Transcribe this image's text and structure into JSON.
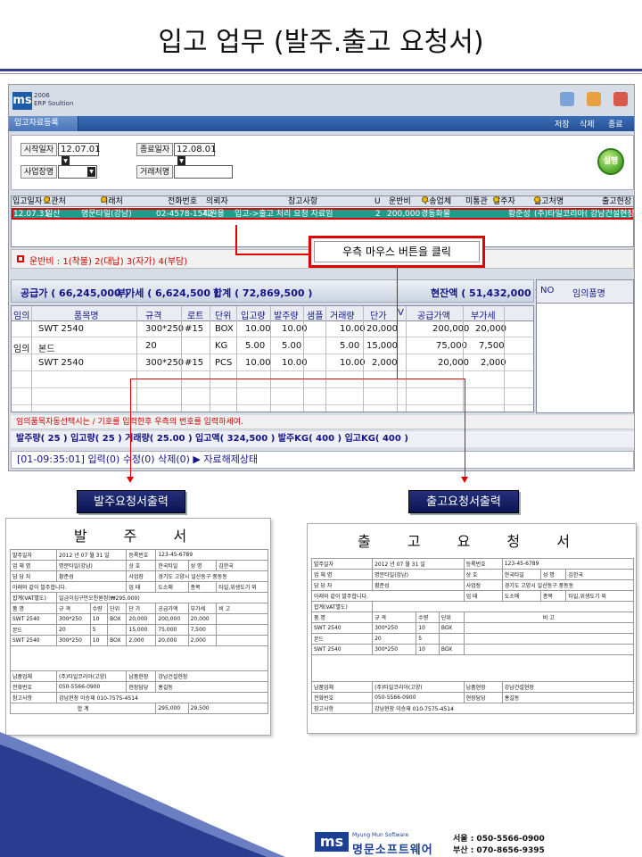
{
  "slide_title": "입고 업무 (발주.출고 요청서)",
  "window": {
    "logo_mark": "ms",
    "logo_year": "2006",
    "logo_text": "ERP Soultion",
    "tab": "입고자료등록",
    "actions": [
      "저장",
      "삭제",
      "종료"
    ]
  },
  "filter": {
    "start_label": "시작일자",
    "start_value": "12.07.01",
    "end_label": "종료일자",
    "end_value": "12.08.01",
    "biz_label": "사업장명",
    "biz_value": "",
    "client_label": "거래처명",
    "client_value": "",
    "run_button": "실행"
  },
  "grid1": {
    "headers": [
      "입고일자",
      "보관처",
      "거래처",
      "전화번호",
      "의뢰자",
      "참고사항",
      "U",
      "운반비",
      "우송업체",
      "미통관",
      "발주자",
      "출고처명",
      "",
      "출고현장"
    ],
    "row": [
      "12.07.31",
      "일산",
      "명문타일(강남)",
      "02-4578-1542",
      "지원용",
      "입고->출고 처리 요청 자료임",
      "2",
      "200,000",
      "경동화물",
      "",
      "황준성",
      "(주)타일코리아(",
      "",
      "강남건설현장"
    ]
  },
  "freight_note": "운반비 : 1(착불) 2(대납) 3(자가) 4(부담)",
  "callout": "우측 마우스 버튼을 클릭",
  "totals": {
    "supply": "공급가 (     66,245,000 )",
    "vat": "부가세 (     6,624,500 )",
    "total": "합계 (     72,869,500 )",
    "cash": "현잔액 (     51,432,000 )"
  },
  "grid2": {
    "headers": [
      "임의",
      "품목명",
      "규격",
      "로트",
      "단위",
      "입고량",
      "발주량",
      "샘플",
      "거래량",
      "단가",
      "V",
      "공급가액",
      "부가세"
    ],
    "rows": [
      [
        "",
        "SWT 2540",
        "300*250",
        "#15",
        "BOX",
        "10.00",
        "10.00",
        "",
        "10.00",
        "20,000",
        "",
        "200,000",
        "20,000"
      ],
      [
        "임의",
        "본드",
        "20",
        "",
        "KG",
        "5.00",
        "5.00",
        "",
        "5.00",
        "15,000",
        "",
        "75,000",
        "7,500"
      ],
      [
        "",
        "SWT 2540",
        "300*250",
        "#15",
        "PCS",
        "10.00",
        "10.00",
        "",
        "10.00",
        "2,000",
        "",
        "20,000",
        "2,000"
      ]
    ]
  },
  "side": {
    "no": "NO",
    "title": "임의품명"
  },
  "hint": "임의품목자동선택시는 / 기호를 입력한후 우측의 번호를 입력하세여.",
  "summary": "발주량(     25 )    입고량(     25 )    거래량(     25.00 )    입고액(          324,500 )    발주KG(     400 )    입고KG(     400 )",
  "status": "[01-09:35:01] 입력(0) 수정(0) 삭제(0) ▶ 자료해제상태",
  "labels": {
    "order": "발주요청서출력",
    "ship": "출고요청서출력"
  },
  "doc_order": {
    "title": "발 주 서",
    "rows": [
      [
        "발주일자",
        "2012 년 07 월 31 일",
        "등록번호",
        "123-45-6789"
      ],
      [
        "업 체 명",
        "명문타일(강남)",
        "상 호",
        "한국타일",
        "성 명",
        "김한국"
      ],
      [
        "담 당 자",
        "황준성",
        "사업장",
        "경기도 고양시 일산동구 풍동동"
      ],
      [
        "아래와 같이 발주합니다.",
        "",
        "업 태",
        "도소매",
        "종목",
        "타일,위생도기 외"
      ],
      [
        "합계(VAT별도)",
        "일금이십구만오천원정(₩295,000)"
      ],
      [
        "품 명",
        "규 격",
        "수량",
        "단위",
        "단 가",
        "공급가액",
        "부가세",
        "비 고"
      ],
      [
        "SWT 2540",
        "300*250",
        "10",
        "BOX",
        "20,000",
        "200,000",
        "20,000",
        ""
      ],
      [
        "본드",
        "20",
        "5",
        "",
        "15,000",
        "75,000",
        "7,500",
        ""
      ],
      [
        "SWT 2540",
        "300*250",
        "10",
        "BOX",
        "2,000",
        "20,000",
        "2,000",
        ""
      ],
      [
        "납품업체",
        "(주)타일코리아(고양)",
        "납품현장",
        "강남건설현장"
      ],
      [
        "전화번호",
        "050-5566-0900",
        "현장담당",
        "홍길동"
      ],
      [
        "참고사항",
        "강남현장 이승재 010-7575-4514"
      ],
      [
        "합 계",
        "",
        "295,000",
        "29,500"
      ]
    ]
  },
  "doc_ship": {
    "title": "출 고 요 청 서",
    "rows": [
      [
        "발주일자",
        "2012 년 07 월 31 일",
        "등록번호",
        "123-45-6789"
      ],
      [
        "업 체 명",
        "명문타일(강남)",
        "상 호",
        "한국타일",
        "성 명",
        "김한국"
      ],
      [
        "담 당 자",
        "황준성",
        "사업장",
        "경기도 고양시 일산동구 풍동동"
      ],
      [
        "아래와 같이 발주합니다.",
        "",
        "업 태",
        "도소매",
        "종목",
        "타일,위생도기 외"
      ],
      [
        "합계(VAT별도)",
        ""
      ],
      [
        "품 명",
        "규 격",
        "수량",
        "단위",
        "비 고"
      ],
      [
        "SWT 2540",
        "300*250",
        "10",
        "BOX",
        ""
      ],
      [
        "본드",
        "20",
        "5",
        "",
        ""
      ],
      [
        "SWT 2540",
        "300*250",
        "10",
        "BOX",
        ""
      ],
      [
        "납품업체",
        "(주)타일코리아(고양)",
        "납품현장",
        "강남건설현장"
      ],
      [
        "전화번호",
        "050-5566-0900",
        "현장담당",
        "홍길동"
      ],
      [
        "참고사항",
        "강남현장 이승재 010-7575-4514"
      ]
    ]
  },
  "brand": {
    "mark": "ms",
    "software": "Myung Mun Software",
    "name": "명문소프트웨어",
    "seoul": "서울 : 050-5566-0900",
    "busan": "부산 : 070-8656-9395"
  }
}
